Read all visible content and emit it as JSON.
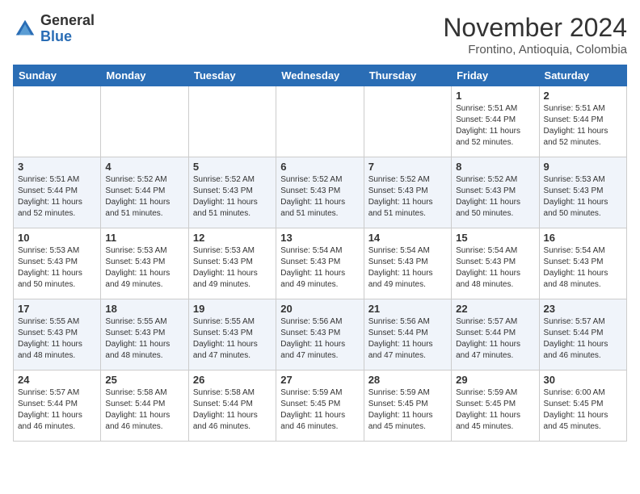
{
  "logo": {
    "general": "General",
    "blue": "Blue"
  },
  "title": "November 2024",
  "location": "Frontino, Antioquia, Colombia",
  "days_of_week": [
    "Sunday",
    "Monday",
    "Tuesday",
    "Wednesday",
    "Thursday",
    "Friday",
    "Saturday"
  ],
  "weeks": [
    [
      {
        "day": "",
        "info": ""
      },
      {
        "day": "",
        "info": ""
      },
      {
        "day": "",
        "info": ""
      },
      {
        "day": "",
        "info": ""
      },
      {
        "day": "",
        "info": ""
      },
      {
        "day": "1",
        "info": "Sunrise: 5:51 AM\nSunset: 5:44 PM\nDaylight: 11 hours\nand 52 minutes."
      },
      {
        "day": "2",
        "info": "Sunrise: 5:51 AM\nSunset: 5:44 PM\nDaylight: 11 hours\nand 52 minutes."
      }
    ],
    [
      {
        "day": "3",
        "info": "Sunrise: 5:51 AM\nSunset: 5:44 PM\nDaylight: 11 hours\nand 52 minutes."
      },
      {
        "day": "4",
        "info": "Sunrise: 5:52 AM\nSunset: 5:44 PM\nDaylight: 11 hours\nand 51 minutes."
      },
      {
        "day": "5",
        "info": "Sunrise: 5:52 AM\nSunset: 5:43 PM\nDaylight: 11 hours\nand 51 minutes."
      },
      {
        "day": "6",
        "info": "Sunrise: 5:52 AM\nSunset: 5:43 PM\nDaylight: 11 hours\nand 51 minutes."
      },
      {
        "day": "7",
        "info": "Sunrise: 5:52 AM\nSunset: 5:43 PM\nDaylight: 11 hours\nand 51 minutes."
      },
      {
        "day": "8",
        "info": "Sunrise: 5:52 AM\nSunset: 5:43 PM\nDaylight: 11 hours\nand 50 minutes."
      },
      {
        "day": "9",
        "info": "Sunrise: 5:53 AM\nSunset: 5:43 PM\nDaylight: 11 hours\nand 50 minutes."
      }
    ],
    [
      {
        "day": "10",
        "info": "Sunrise: 5:53 AM\nSunset: 5:43 PM\nDaylight: 11 hours\nand 50 minutes."
      },
      {
        "day": "11",
        "info": "Sunrise: 5:53 AM\nSunset: 5:43 PM\nDaylight: 11 hours\nand 49 minutes."
      },
      {
        "day": "12",
        "info": "Sunrise: 5:53 AM\nSunset: 5:43 PM\nDaylight: 11 hours\nand 49 minutes."
      },
      {
        "day": "13",
        "info": "Sunrise: 5:54 AM\nSunset: 5:43 PM\nDaylight: 11 hours\nand 49 minutes."
      },
      {
        "day": "14",
        "info": "Sunrise: 5:54 AM\nSunset: 5:43 PM\nDaylight: 11 hours\nand 49 minutes."
      },
      {
        "day": "15",
        "info": "Sunrise: 5:54 AM\nSunset: 5:43 PM\nDaylight: 11 hours\nand 48 minutes."
      },
      {
        "day": "16",
        "info": "Sunrise: 5:54 AM\nSunset: 5:43 PM\nDaylight: 11 hours\nand 48 minutes."
      }
    ],
    [
      {
        "day": "17",
        "info": "Sunrise: 5:55 AM\nSunset: 5:43 PM\nDaylight: 11 hours\nand 48 minutes."
      },
      {
        "day": "18",
        "info": "Sunrise: 5:55 AM\nSunset: 5:43 PM\nDaylight: 11 hours\nand 48 minutes."
      },
      {
        "day": "19",
        "info": "Sunrise: 5:55 AM\nSunset: 5:43 PM\nDaylight: 11 hours\nand 47 minutes."
      },
      {
        "day": "20",
        "info": "Sunrise: 5:56 AM\nSunset: 5:43 PM\nDaylight: 11 hours\nand 47 minutes."
      },
      {
        "day": "21",
        "info": "Sunrise: 5:56 AM\nSunset: 5:44 PM\nDaylight: 11 hours\nand 47 minutes."
      },
      {
        "day": "22",
        "info": "Sunrise: 5:57 AM\nSunset: 5:44 PM\nDaylight: 11 hours\nand 47 minutes."
      },
      {
        "day": "23",
        "info": "Sunrise: 5:57 AM\nSunset: 5:44 PM\nDaylight: 11 hours\nand 46 minutes."
      }
    ],
    [
      {
        "day": "24",
        "info": "Sunrise: 5:57 AM\nSunset: 5:44 PM\nDaylight: 11 hours\nand 46 minutes."
      },
      {
        "day": "25",
        "info": "Sunrise: 5:58 AM\nSunset: 5:44 PM\nDaylight: 11 hours\nand 46 minutes."
      },
      {
        "day": "26",
        "info": "Sunrise: 5:58 AM\nSunset: 5:44 PM\nDaylight: 11 hours\nand 46 minutes."
      },
      {
        "day": "27",
        "info": "Sunrise: 5:59 AM\nSunset: 5:45 PM\nDaylight: 11 hours\nand 46 minutes."
      },
      {
        "day": "28",
        "info": "Sunrise: 5:59 AM\nSunset: 5:45 PM\nDaylight: 11 hours\nand 45 minutes."
      },
      {
        "day": "29",
        "info": "Sunrise: 5:59 AM\nSunset: 5:45 PM\nDaylight: 11 hours\nand 45 minutes."
      },
      {
        "day": "30",
        "info": "Sunrise: 6:00 AM\nSunset: 5:45 PM\nDaylight: 11 hours\nand 45 minutes."
      }
    ]
  ]
}
